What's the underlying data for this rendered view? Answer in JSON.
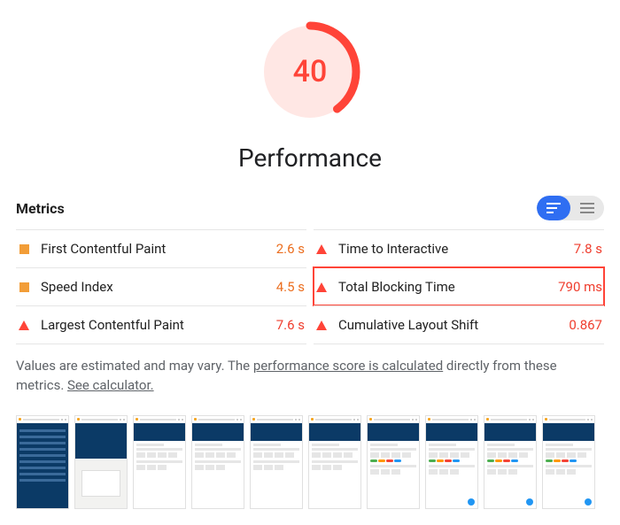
{
  "score": "40",
  "score_color": "#ff4438",
  "score_bg": "#ffe7e4",
  "title": "Performance",
  "metrics_heading": "Metrics",
  "toggle": {
    "view": "condensed"
  },
  "metrics": [
    {
      "shape": "square",
      "label": "First Contentful Paint",
      "value": "2.6 s",
      "status": "warn"
    },
    {
      "shape": "triangle",
      "label": "Time to Interactive",
      "value": "7.8 s",
      "status": "bad"
    },
    {
      "shape": "square",
      "label": "Speed Index",
      "value": "4.5 s",
      "status": "warn"
    },
    {
      "shape": "triangle",
      "label": "Total Blocking Time",
      "value": "790 ms",
      "status": "bad",
      "highlight": true
    },
    {
      "shape": "triangle",
      "label": "Largest Contentful Paint",
      "value": "7.6 s",
      "status": "bad"
    },
    {
      "shape": "triangle",
      "label": "Cumulative Layout Shift",
      "value": "0.867",
      "status": "bad"
    }
  ],
  "footnote": {
    "pre": "Values are estimated and may vary. The ",
    "link1": "performance score is calculated",
    "mid": " directly from these metrics. ",
    "link2": "See calculator."
  },
  "thumbnails": [
    {
      "type": "nav-full"
    },
    {
      "type": "modal"
    },
    {
      "type": "blocks"
    },
    {
      "type": "blocks"
    },
    {
      "type": "blocks"
    },
    {
      "type": "blocks"
    },
    {
      "type": "blocks-pills"
    },
    {
      "type": "blocks-pills"
    },
    {
      "type": "blocks-pills"
    },
    {
      "type": "blocks-pills"
    }
  ]
}
